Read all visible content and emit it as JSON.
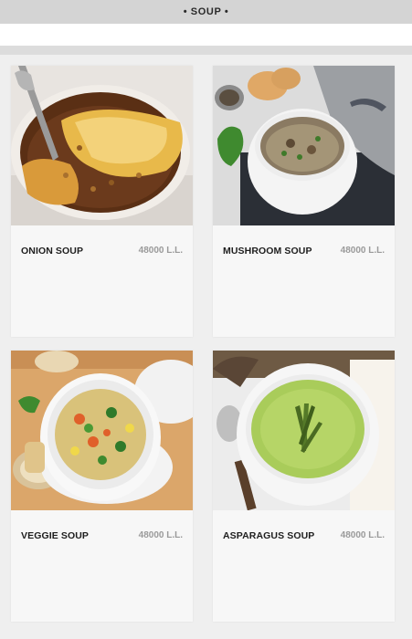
{
  "section": {
    "title": "• SOUP •"
  },
  "items": [
    {
      "name": "ONION SOUP",
      "price": "48000 L.L."
    },
    {
      "name": "MUSHROOM SOUP",
      "price": "48000 L.L."
    },
    {
      "name": "VEGGIE SOUP",
      "price": "48000 L.L."
    },
    {
      "name": "ASPARAGUS SOUP",
      "price": "48000 L.L."
    }
  ],
  "colors": {
    "onion_broth": "#6b3a1c",
    "mushroom_cream": "#b8ad95",
    "veggie_broth": "#d9c27a",
    "asparagus_cream": "#a9cc5a"
  }
}
